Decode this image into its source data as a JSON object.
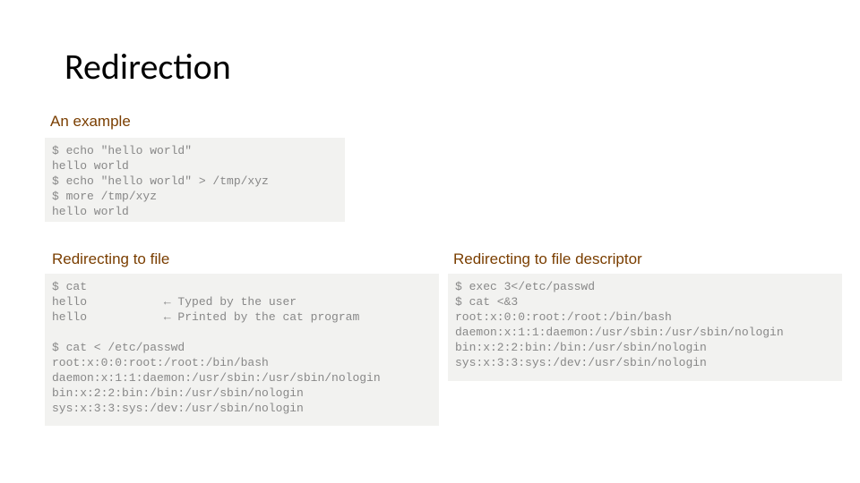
{
  "title": "Redirection",
  "headings": {
    "example": "An example",
    "to_file": "Redirecting to file",
    "to_fd": "Redirecting to file descriptor"
  },
  "code": {
    "example": "$ echo \"hello world\"\nhello world\n$ echo \"hello world\" > /tmp/xyz\n$ more /tmp/xyz\nhello world",
    "to_file": "$ cat\nhello           ← Typed by the user\nhello           ← Printed by the cat program\n\n$ cat < /etc/passwd\nroot:x:0:0:root:/root:/bin/bash\ndaemon:x:1:1:daemon:/usr/sbin:/usr/sbin/nologin\nbin:x:2:2:bin:/bin:/usr/sbin/nologin\nsys:x:3:3:sys:/dev:/usr/sbin/nologin",
    "to_fd": "$ exec 3</etc/passwd\n$ cat <&3\nroot:x:0:0:root:/root:/bin/bash\ndaemon:x:1:1:daemon:/usr/sbin:/usr/sbin/nologin\nbin:x:2:2:bin:/bin:/usr/sbin/nologin\nsys:x:3:3:sys:/dev:/usr/sbin/nologin"
  }
}
